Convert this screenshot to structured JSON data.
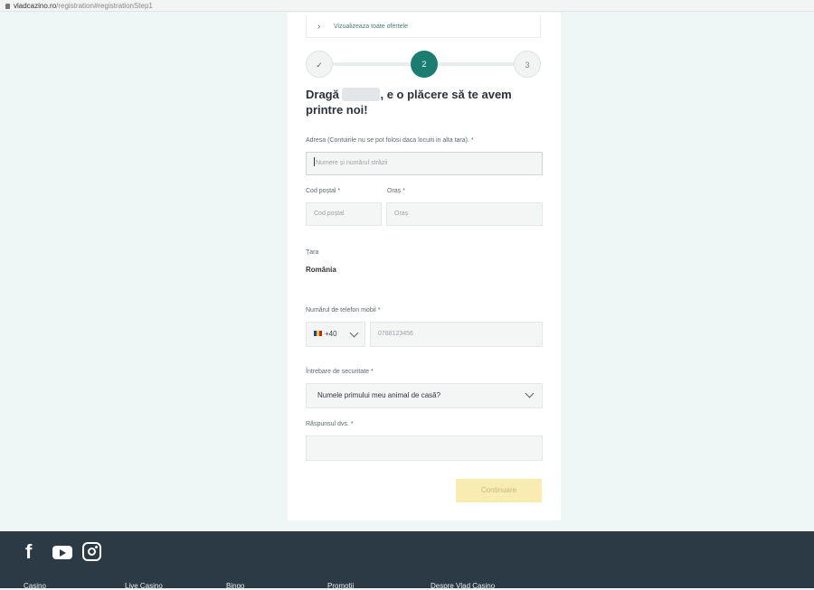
{
  "browser": {
    "host": "vladcazino.ro",
    "path": "/registration#registrationStep1"
  },
  "offers_link": "Vizualizeaza toate ofertele",
  "stepper": {
    "steps": [
      "✓",
      "2",
      "3"
    ]
  },
  "greeting": {
    "prefix": "Dragă",
    "suffix": ", e o plăcere să te avem printre noi!"
  },
  "form": {
    "address_label": "Adresa (Contuirile nu se pot folosi daca locuiti in alta tara). *",
    "address_placeholder": "Numere și numărul străzii",
    "postal_label": "Cod poștal *",
    "postal_placeholder": "Cod poștal",
    "city_label": "Oraș *",
    "city_placeholder": "Oraș",
    "country_label": "Țara",
    "country_value": "România",
    "phone_label": "Numărul de telefon mobil *",
    "phone_prefix": "+40",
    "phone_placeholder": "0788123456",
    "security_label": "Întrebare de securitate *",
    "security_value": "Numele primului meu animal de casă?",
    "answer_label": "Răspunsul dvs. *",
    "continue_label": "Continuare"
  },
  "footer": {
    "nav": [
      "Casino",
      "Live Casino",
      "Bingo",
      "Promoții",
      "Despre Vlad Casino"
    ]
  },
  "colors": {
    "accent": "#1a7d6f",
    "footer_bg": "#2c3a46",
    "continue_disabled": "#f8ecb0",
    "page_bg": "#eef7f5"
  },
  "icons": {
    "social": [
      "facebook-icon",
      "youtube-icon",
      "instagram-icon"
    ]
  }
}
